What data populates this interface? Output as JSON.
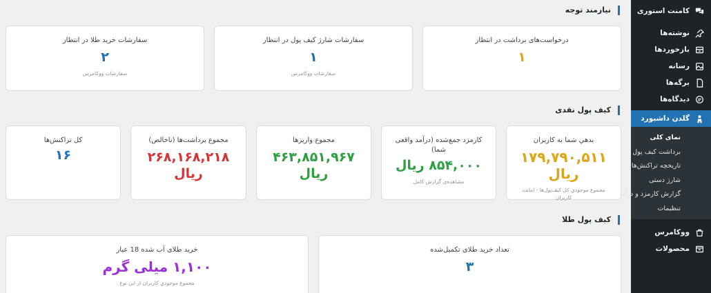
{
  "colors": {
    "accent": "#2271b1",
    "orange": "#dba617",
    "green": "#2ea043",
    "red": "#d63638",
    "purple": "#9b30d9",
    "sidebar": "#1d2327"
  },
  "sidebar": {
    "items_top": [
      {
        "label": "کامنت استوری",
        "icon": "comments-icon"
      },
      {
        "label": "نوشته‌ها",
        "icon": "pin-icon"
      },
      {
        "label": "بازخوردها",
        "icon": "feedback-icon"
      },
      {
        "label": "رسانه",
        "icon": "media-icon"
      },
      {
        "label": "برگه‌ها",
        "icon": "page-icon"
      },
      {
        "label": "دیدگاه‌ها",
        "icon": "comment-icon"
      }
    ],
    "active": {
      "label": "گلدن داشبورد",
      "icon": "golden-dashboard-icon"
    },
    "submenu": [
      "نمای کلی",
      "برداشت کیف پول",
      "تاریخچه تراکنش‌ها",
      "شارژ دستی",
      "گزارش کارمزد و درآمد",
      "تنظیمات"
    ],
    "items_bottom": [
      {
        "label": "ووکامرس",
        "icon": "woocommerce-icon"
      },
      {
        "label": "محصولات",
        "icon": "products-icon"
      }
    ]
  },
  "attention": {
    "title": "نیازمند توجه",
    "cards": [
      {
        "label": "درخواست‌های برداشت در انتظار",
        "value": "۱",
        "sub": ""
      },
      {
        "label": "سفارشات شارژ کیف پول در انتظار",
        "value": "۱",
        "sub": "سفارشات ووکامرس"
      },
      {
        "label": "سفارشات خرید طلا در انتظار",
        "value": "۲",
        "sub": "سفارشات ووکامرس"
      }
    ]
  },
  "cash_wallet": {
    "title": "کیف پول نقدی",
    "cards": [
      {
        "label": "بدهي شما به کاربران",
        "value": "۱۷۹,۷۹۰,۵۱۱ ریال",
        "sub": "مجموع موجودي کل کیف‌پول‌ها - امانت کاربران"
      },
      {
        "label": "کارمزد جمع‌شده (درآمد واقعی شما)",
        "value": "۸۵۴,۰۰۰ ریال",
        "sub": "مشاهده‌ی گزارش کامل"
      },
      {
        "label": "مجموع واریزها",
        "value_line1": "۴۶۳,۸۵۱,۹۶۷",
        "value_line2": "ریال"
      },
      {
        "label": "مجموع برداشت‌ها (ناخالص)",
        "value_line1": "۲۶۸,۱۶۸,۲۱۸",
        "value_line2": "ریال"
      },
      {
        "label": "کل تراکنش‌ها",
        "value": "۱۶"
      }
    ]
  },
  "gold_wallet": {
    "title": "کیف پول طلا",
    "cards": [
      {
        "label": "تعداد خرید طلای تکمیل‌شده",
        "value": "۳"
      },
      {
        "label": "خرید طلای آب شده 18 عیار",
        "value": "۱,۱۰۰ میلی گرم",
        "sub": "مجموع موجودي کاربران از این نوع"
      }
    ]
  }
}
